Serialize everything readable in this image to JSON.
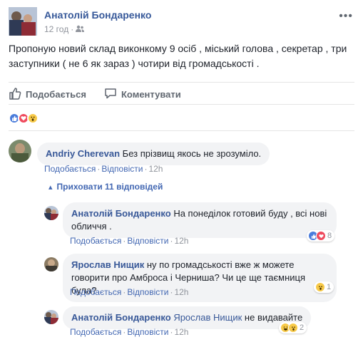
{
  "post": {
    "author": "Анатолій Бондаренко",
    "time": "12 год",
    "privacy_icon": "friends-icon",
    "options_icon": "more-options-icon",
    "text": "Пропоную новий склад виконкому 9 осіб , міський голова , секретар , три заступники ( не 6 як зараз ) чотири від громадськості ."
  },
  "actions": {
    "like_label": "Подобається",
    "comment_label": "Коментувати"
  },
  "post_reactions": [
    "like-icon",
    "love-icon",
    "wow-icon"
  ],
  "comments": [
    {
      "author": "Andriy Cherevan",
      "text": "Без прізвищ якось не зрозуміло.",
      "like": "Подобається",
      "reply": "Відповісти",
      "time": "12h"
    }
  ],
  "hide_replies_label": "Приховати 11 відповідей",
  "replies": [
    {
      "author": "Анатолій Бондаренко",
      "text": "На понеділок готовий буду , всі нові обличчя .",
      "like": "Подобається",
      "reply": "Відповісти",
      "time": "12h",
      "reaction_count": "8"
    },
    {
      "author": "Ярослав Нищик",
      "text": "ну по громадськості вже ж можете говорити про Амброса і Черниша? Чи це ще таємниця була?",
      "like": "Подобається",
      "reply": "Відповісти",
      "time": "12h",
      "reaction_count": "1"
    },
    {
      "author": "Анатолій Бондаренко",
      "tag": "Ярослав Нищик",
      "text": "не видавайте",
      "like": "Подобається",
      "reply": "Відповісти",
      "time": "12h",
      "reaction_count": "2"
    }
  ],
  "colors": {
    "link": "#365899",
    "muted": "#90949c",
    "bubble": "#f2f3f5",
    "like": "#4a7cdb",
    "love": "#ef4b5e",
    "wow": "#f7c948"
  }
}
